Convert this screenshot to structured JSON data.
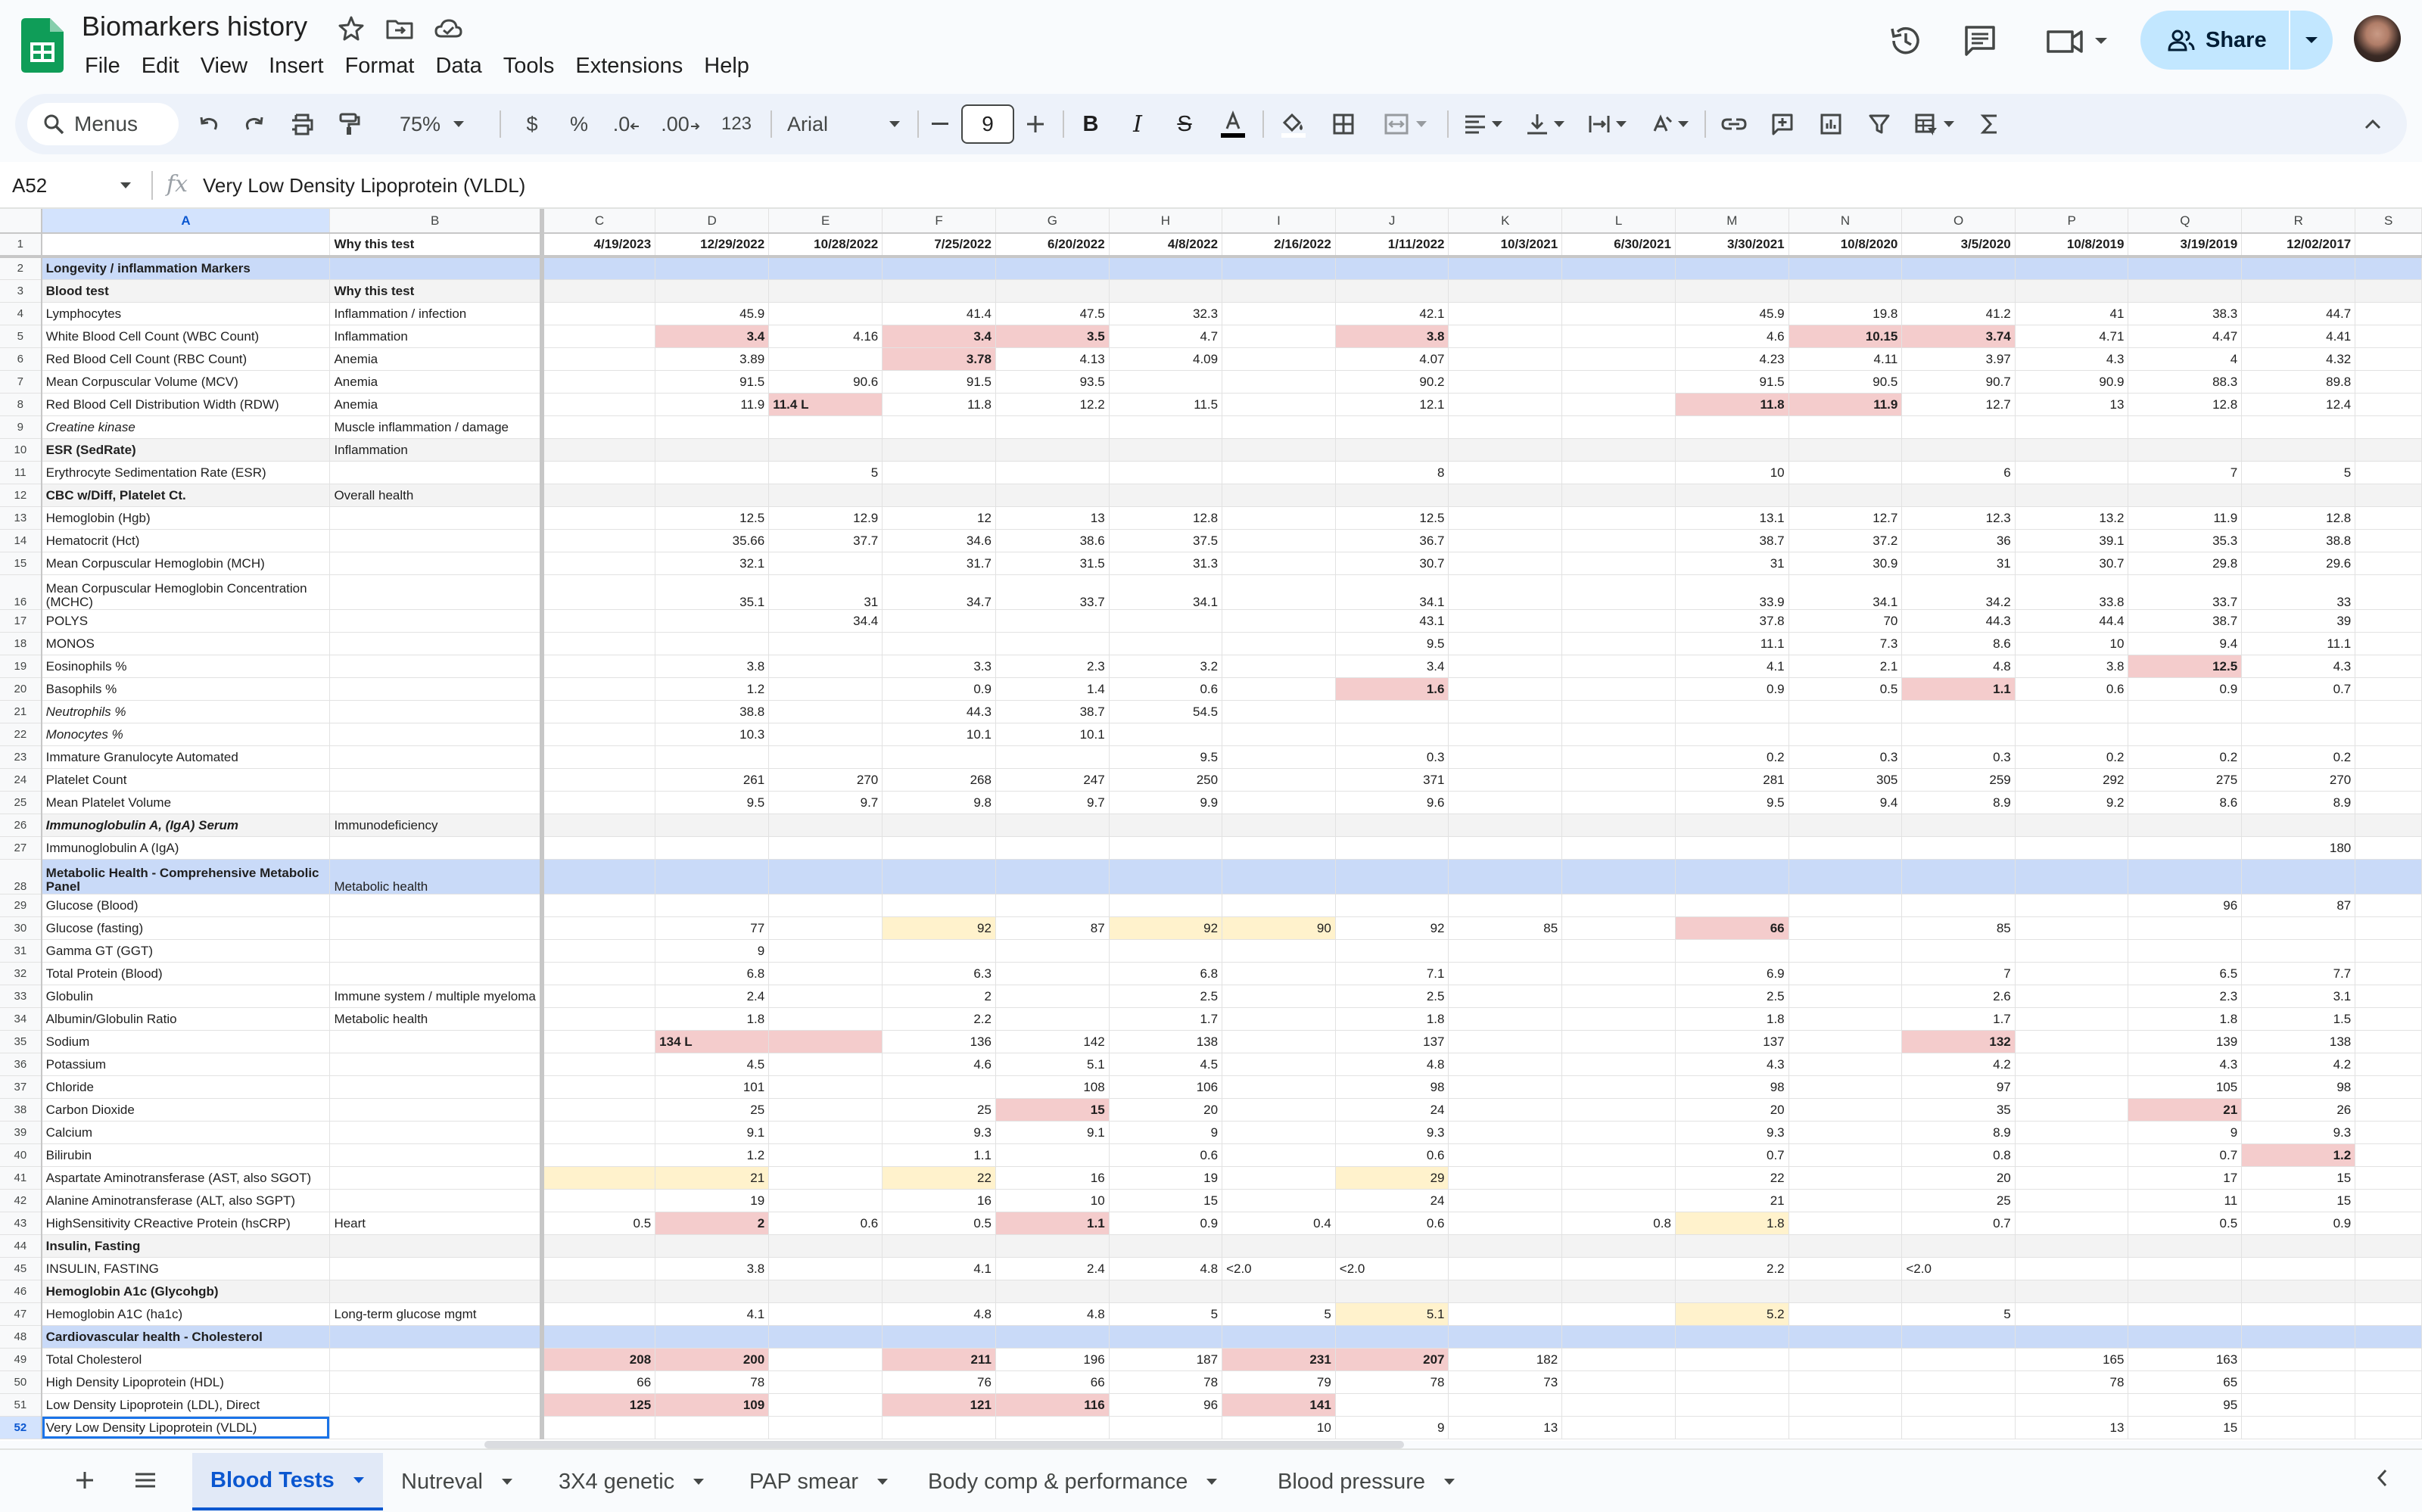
{
  "title": "Biomarkers history",
  "menu": [
    "File",
    "Edit",
    "View",
    "Insert",
    "Format",
    "Data",
    "Tools",
    "Extensions",
    "Help"
  ],
  "share_label": "Share",
  "toolbar": {
    "search": "Menus",
    "zoom": "75%",
    "currency": "$",
    "percent": "%",
    "dec_dec": ".0",
    "inc_dec": ".00",
    "number_format": "123",
    "font": "Arial",
    "font_size": "9"
  },
  "formula_bar": {
    "cell_ref": "A52",
    "fx": "fx",
    "value": "Very Low Density Lipoprotein (VLDL)"
  },
  "columns": [
    "A",
    "B",
    "C",
    "D",
    "E",
    "F",
    "G",
    "H",
    "I",
    "J",
    "K",
    "L",
    "M",
    "N",
    "O",
    "P",
    "Q",
    "R",
    "S"
  ],
  "rows": [
    {
      "n": "1",
      "cells": [
        "",
        "Why this test",
        "4/19/2023",
        "12/29/2022",
        "10/28/2022",
        "7/25/2022",
        "6/20/2022",
        "4/8/2022",
        "2/16/2022",
        "1/11/2022",
        "10/3/2021",
        "6/30/2021",
        "3/30/2021",
        "10/8/2020",
        "3/5/2020",
        "10/8/2019",
        "3/19/2019",
        "12/02/2017"
      ]
    },
    {
      "n": "2",
      "cells": [
        "Longevity / inflammation Markers"
      ]
    },
    {
      "n": "3",
      "cells": [
        "Blood test",
        "Why this test"
      ]
    },
    {
      "n": "4",
      "cells": [
        "Lymphocytes",
        "Inflammation / infection",
        "",
        "45.9",
        "",
        "41.4",
        "47.5",
        "32.3",
        "",
        "42.1",
        "",
        "",
        "45.9",
        "19.8",
        "41.2",
        "41",
        "38.3",
        "44.7"
      ]
    },
    {
      "n": "5",
      "cells": [
        "White Blood Cell Count (WBC Count)",
        "Inflammation",
        "",
        "3.4",
        "4.16",
        "3.4",
        "3.5",
        "4.7",
        "",
        "3.8",
        "",
        "",
        "4.6",
        "10.15",
        "3.74",
        "4.71",
        "4.47",
        "4.41"
      ]
    },
    {
      "n": "6",
      "cells": [
        "Red Blood Cell Count (RBC Count)",
        "Anemia",
        "",
        "3.89",
        "",
        "3.78",
        "4.13",
        "4.09",
        "",
        "4.07",
        "",
        "",
        "4.23",
        "4.11",
        "3.97",
        "4.3",
        "4",
        "4.32"
      ]
    },
    {
      "n": "7",
      "cells": [
        "Mean Corpuscular Volume (MCV)",
        "Anemia",
        "",
        "91.5",
        "90.6",
        "91.5",
        "93.5",
        "",
        "",
        "90.2",
        "",
        "",
        "91.5",
        "90.5",
        "90.7",
        "90.9",
        "88.3",
        "89.8"
      ]
    },
    {
      "n": "8",
      "cells": [
        "Red Blood Cell Distribution Width (RDW)",
        "Anemia",
        "",
        "11.9",
        "11.4 L",
        "11.8",
        "12.2",
        "11.5",
        "",
        "12.1",
        "",
        "",
        "11.8",
        "11.9",
        "12.7",
        "13",
        "12.8",
        "12.4"
      ]
    },
    {
      "n": "9",
      "cells": [
        "Creatine kinase",
        "Muscle inflammation / damage"
      ]
    },
    {
      "n": "10",
      "cells": [
        "ESR (SedRate)",
        "Inflammation"
      ]
    },
    {
      "n": "11",
      "cells": [
        "Erythrocyte Sedimentation Rate (ESR)",
        "",
        "",
        "",
        "5",
        "",
        "",
        "",
        "",
        "8",
        "",
        "",
        "10",
        "",
        "6",
        "",
        "7",
        "5"
      ]
    },
    {
      "n": "12",
      "cells": [
        "CBC w/Diff, Platelet Ct.",
        "Overall health"
      ]
    },
    {
      "n": "13",
      "cells": [
        "Hemoglobin (Hgb)",
        "",
        "",
        "12.5",
        "12.9",
        "12",
        "13",
        "12.8",
        "",
        "12.5",
        "",
        "",
        "13.1",
        "12.7",
        "12.3",
        "13.2",
        "11.9",
        "12.8"
      ]
    },
    {
      "n": "14",
      "cells": [
        "Hematocrit (Hct)",
        "",
        "",
        "35.66",
        "37.7",
        "34.6",
        "38.6",
        "37.5",
        "",
        "36.7",
        "",
        "",
        "38.7",
        "37.2",
        "36",
        "39.1",
        "35.3",
        "38.8"
      ]
    },
    {
      "n": "15",
      "cells": [
        "Mean Corpuscular Hemoglobin (MCH)",
        "",
        "",
        "32.1",
        "",
        "31.7",
        "31.5",
        "31.3",
        "",
        "30.7",
        "",
        "",
        "31",
        "30.9",
        "31",
        "30.7",
        "29.8",
        "29.6"
      ]
    },
    {
      "n": "16",
      "cells": [
        "Mean Corpuscular Hemoglobin Concentration (MCHC)",
        "",
        "",
        "35.1",
        "31",
        "34.7",
        "33.7",
        "34.1",
        "",
        "34.1",
        "",
        "",
        "33.9",
        "34.1",
        "34.2",
        "33.8",
        "33.7",
        "33"
      ]
    },
    {
      "n": "17",
      "cells": [
        "POLYS",
        "",
        "",
        "",
        "34.4",
        "",
        "",
        "",
        "",
        "43.1",
        "",
        "",
        "37.8",
        "70",
        "44.3",
        "44.4",
        "38.7",
        "39"
      ]
    },
    {
      "n": "18",
      "cells": [
        "MONOS",
        "",
        "",
        "",
        "",
        "",
        "",
        "",
        "",
        "9.5",
        "",
        "",
        "11.1",
        "7.3",
        "8.6",
        "10",
        "9.4",
        "11.1"
      ]
    },
    {
      "n": "19",
      "cells": [
        "Eosinophils %",
        "",
        "",
        "3.8",
        "",
        "3.3",
        "2.3",
        "3.2",
        "",
        "3.4",
        "",
        "",
        "4.1",
        "2.1",
        "4.8",
        "3.8",
        "12.5",
        "4.3"
      ]
    },
    {
      "n": "20",
      "cells": [
        "Basophils %",
        "",
        "",
        "1.2",
        "",
        "0.9",
        "1.4",
        "0.6",
        "",
        "1.6",
        "",
        "",
        "0.9",
        "0.5",
        "1.1",
        "0.6",
        "0.9",
        "0.7"
      ]
    },
    {
      "n": "21",
      "cells": [
        "Neutrophils %",
        "",
        "",
        "38.8",
        "",
        "44.3",
        "38.7",
        "54.5"
      ]
    },
    {
      "n": "22",
      "cells": [
        "Monocytes %",
        "",
        "",
        "10.3",
        "",
        "10.1",
        "10.1"
      ]
    },
    {
      "n": "23",
      "cells": [
        "Immature Granulocyte Automated",
        "",
        "",
        "",
        "",
        "",
        "",
        "9.5",
        "",
        "0.3",
        "",
        "",
        "0.2",
        "0.3",
        "0.3",
        "0.2",
        "0.2",
        "0.2"
      ]
    },
    {
      "n": "24",
      "cells": [
        "Platelet Count",
        "",
        "",
        "261",
        "270",
        "268",
        "247",
        "250",
        "",
        "371",
        "",
        "",
        "281",
        "305",
        "259",
        "292",
        "275",
        "270"
      ]
    },
    {
      "n": "25",
      "cells": [
        "Mean Platelet Volume",
        "",
        "",
        "9.5",
        "9.7",
        "9.8",
        "9.7",
        "9.9",
        "",
        "9.6",
        "",
        "",
        "9.5",
        "9.4",
        "8.9",
        "9.2",
        "8.6",
        "8.9"
      ]
    },
    {
      "n": "26",
      "cells": [
        "Immunoglobulin A, (IgA) Serum",
        "Immunodeficiency"
      ]
    },
    {
      "n": "27",
      "cells": [
        "Immunoglobulin A (IgA)",
        "",
        "",
        "",
        "",
        "",
        "",
        "",
        "",
        "",
        "",
        "",
        "",
        "",
        "",
        "",
        "",
        "180"
      ]
    },
    {
      "n": "28",
      "cells": [
        "Metabolic Health - Comprehensive Metabolic Panel",
        "Metabolic health"
      ]
    },
    {
      "n": "29",
      "cells": [
        "Glucose (Blood)",
        "",
        "",
        "",
        "",
        "",
        "",
        "",
        "",
        "",
        "",
        "",
        "",
        "",
        "",
        "",
        "96",
        "87"
      ]
    },
    {
      "n": "30",
      "cells": [
        "Glucose (fasting)",
        "",
        "",
        "77",
        "",
        "92",
        "87",
        "92",
        "90",
        "92",
        "85",
        "",
        "66",
        "",
        "85"
      ]
    },
    {
      "n": "31",
      "cells": [
        "Gamma GT (GGT)",
        "",
        "",
        "9"
      ]
    },
    {
      "n": "32",
      "cells": [
        "Total Protein (Blood)",
        "",
        "",
        "6.8",
        "",
        "6.3",
        "",
        "6.8",
        "",
        "7.1",
        "",
        "",
        "6.9",
        "",
        "7",
        "",
        "6.5",
        "7.7"
      ]
    },
    {
      "n": "33",
      "cells": [
        "Globulin",
        "Immune system / multiple myeloma",
        "",
        "2.4",
        "",
        "2",
        "",
        "2.5",
        "",
        "2.5",
        "",
        "",
        "2.5",
        "",
        "2.6",
        "",
        "2.3",
        "3.1"
      ]
    },
    {
      "n": "34",
      "cells": [
        "Albumin/Globulin Ratio",
        "Metabolic health",
        "",
        "1.8",
        "",
        "2.2",
        "",
        "1.7",
        "",
        "1.8",
        "",
        "",
        "1.8",
        "",
        "1.7",
        "",
        "1.8",
        "1.5"
      ]
    },
    {
      "n": "35",
      "cells": [
        "Sodium",
        "",
        "",
        "134 L",
        "",
        "136",
        "142",
        "138",
        "",
        "137",
        "",
        "",
        "137",
        "",
        "132",
        "",
        "139",
        "138"
      ]
    },
    {
      "n": "36",
      "cells": [
        "Potassium",
        "",
        "",
        "4.5",
        "",
        "4.6",
        "5.1",
        "4.5",
        "",
        "4.8",
        "",
        "",
        "4.3",
        "",
        "4.2",
        "",
        "4.3",
        "4.2"
      ]
    },
    {
      "n": "37",
      "cells": [
        "Chloride",
        "",
        "",
        "101",
        "",
        "",
        "108",
        "106",
        "",
        "98",
        "",
        "",
        "98",
        "",
        "97",
        "",
        "105",
        "98"
      ]
    },
    {
      "n": "38",
      "cells": [
        "Carbon Dioxide",
        "",
        "",
        "25",
        "",
        "25",
        "15",
        "20",
        "",
        "24",
        "",
        "",
        "20",
        "",
        "35",
        "",
        "21",
        "26"
      ]
    },
    {
      "n": "39",
      "cells": [
        "Calcium",
        "",
        "",
        "9.1",
        "",
        "9.3",
        "9.1",
        "9",
        "",
        "9.3",
        "",
        "",
        "9.3",
        "",
        "8.9",
        "",
        "9",
        "9.3"
      ]
    },
    {
      "n": "40",
      "cells": [
        "Bilirubin",
        "",
        "",
        "1.2",
        "",
        "1.1",
        "",
        "0.6",
        "",
        "0.6",
        "",
        "",
        "0.7",
        "",
        "0.8",
        "",
        "0.7",
        "1.2"
      ]
    },
    {
      "n": "41",
      "cells": [
        "Aspartate Aminotransferase (AST, also SGOT)",
        "",
        "",
        "21",
        "",
        "22",
        "16",
        "19",
        "",
        "29",
        "",
        "",
        "22",
        "",
        "20",
        "",
        "17",
        "15"
      ]
    },
    {
      "n": "42",
      "cells": [
        "Alanine Aminotransferase (ALT, also SGPT)",
        "",
        "",
        "19",
        "",
        "16",
        "10",
        "15",
        "",
        "24",
        "",
        "",
        "21",
        "",
        "25",
        "",
        "11",
        "15"
      ]
    },
    {
      "n": "43",
      "cells": [
        "HighSensitivity CReactive Protein (hsCRP)",
        "Heart",
        "0.5",
        "2",
        "0.6",
        "0.5",
        "1.1",
        "0.9",
        "0.4",
        "0.6",
        "",
        "0.8",
        "1.8",
        "",
        "0.7",
        "",
        "0.5",
        "0.9"
      ]
    },
    {
      "n": "44",
      "cells": [
        "Insulin, Fasting"
      ]
    },
    {
      "n": "45",
      "cells": [
        "INSULIN, FASTING",
        "",
        "",
        "3.8",
        "",
        "4.1",
        "2.4",
        "4.8",
        "<2.0",
        "<2.0",
        "",
        "",
        "2.2",
        "",
        "<2.0"
      ]
    },
    {
      "n": "46",
      "cells": [
        "Hemoglobin A1c (Glycohgb)"
      ]
    },
    {
      "n": "47",
      "cells": [
        "Hemoglobin A1C (ha1c)",
        "Long-term glucose mgmt",
        "",
        "4.1",
        "",
        "4.8",
        "4.8",
        "5",
        "5",
        "5.1",
        "",
        "",
        "5.2",
        "",
        "5"
      ]
    },
    {
      "n": "48",
      "cells": [
        "Cardiovascular health - Cholesterol"
      ]
    },
    {
      "n": "49",
      "cells": [
        "Total Cholesterol",
        "",
        "208",
        "200",
        "",
        "211",
        "196",
        "187",
        "231",
        "207",
        "182",
        "",
        "",
        "",
        "",
        "165",
        "163"
      ]
    },
    {
      "n": "50",
      "cells": [
        "High Density Lipoprotein (HDL)",
        "",
        "66",
        "78",
        "",
        "76",
        "66",
        "78",
        "79",
        "78",
        "73",
        "",
        "",
        "",
        "",
        "78",
        "65"
      ]
    },
    {
      "n": "51",
      "cells": [
        "Low Density Lipoprotein (LDL), Direct",
        "",
        "125",
        "109",
        "",
        "121",
        "116",
        "96",
        "141",
        "",
        "",
        "",
        "",
        "",
        "",
        "",
        "95"
      ]
    },
    {
      "n": "52",
      "cells": [
        "Very Low Density Lipoprotein (VLDL)",
        "",
        "",
        "",
        "",
        "",
        "",
        "",
        "10",
        "9",
        "13",
        "",
        "",
        "",
        "",
        "13",
        "15"
      ]
    }
  ],
  "sheet_tabs": [
    "Blood Tests",
    "Nutreval",
    "3X4 genetic",
    "PAP smear",
    "Body comp & performance",
    "Blood pressure"
  ],
  "active_tab": "Blood Tests"
}
